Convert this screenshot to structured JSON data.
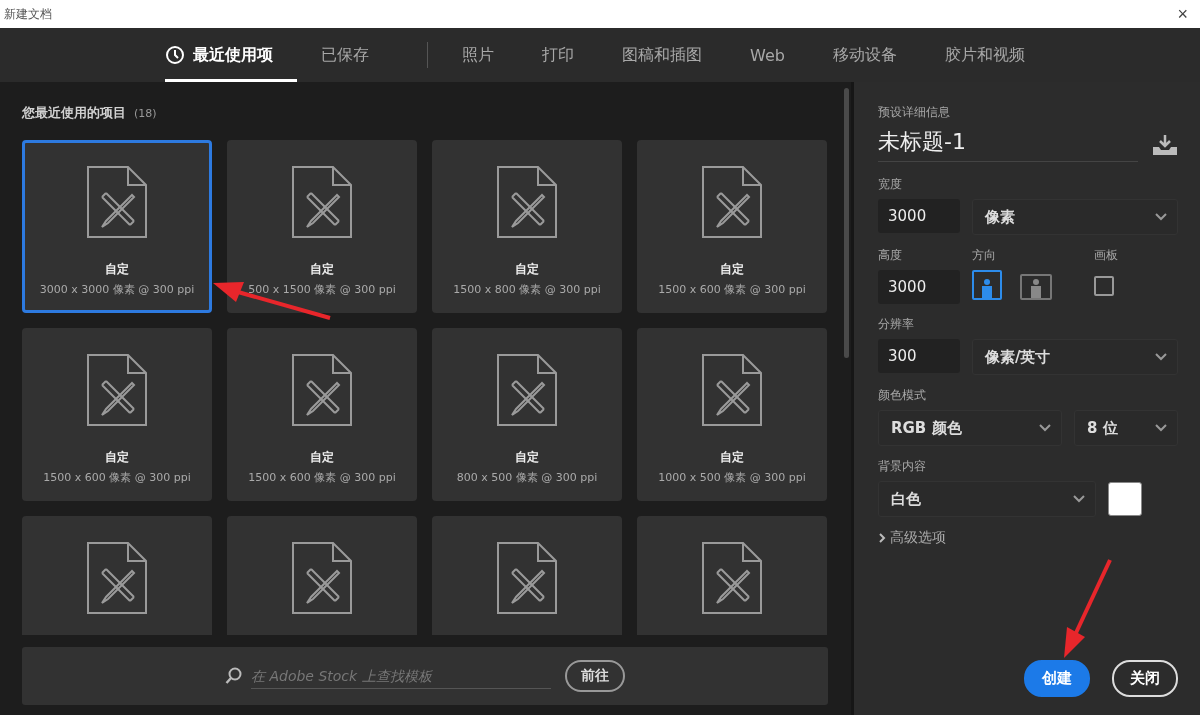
{
  "window": {
    "title": "新建文档",
    "close": "×"
  },
  "tabs": [
    {
      "label": "最近使用项",
      "kind": "recent",
      "selected": true
    },
    {
      "label": "已保存",
      "kind": "saved",
      "selected": false
    },
    {
      "label": "照片",
      "kind": "preset",
      "selected": false
    },
    {
      "label": "打印",
      "kind": "preset",
      "selected": false
    },
    {
      "label": "图稿和插图",
      "kind": "preset",
      "selected": false
    },
    {
      "label": "Web",
      "kind": "preset",
      "selected": false
    },
    {
      "label": "移动设备",
      "kind": "preset",
      "selected": false
    },
    {
      "label": "胶片和视频",
      "kind": "preset",
      "selected": false
    }
  ],
  "recent": {
    "heading": "您最近使用的项目",
    "count": "(18)",
    "items": [
      {
        "kind": "full",
        "name": "自定",
        "size": "3000 x 3000 像素 @ 300 ppi",
        "selected": true
      },
      {
        "kind": "full",
        "name": "自定",
        "size": "500 x 1500 像素 @ 300 ppi",
        "selected": false
      },
      {
        "kind": "full",
        "name": "自定",
        "size": "1500 x 800 像素 @ 300 ppi",
        "selected": false
      },
      {
        "kind": "full",
        "name": "自定",
        "size": "1500 x 600 像素 @ 300 ppi",
        "selected": false
      },
      {
        "kind": "full",
        "name": "自定",
        "size": "1500 x 600 像素 @ 300 ppi",
        "selected": false
      },
      {
        "kind": "full",
        "name": "自定",
        "size": "1500 x 600 像素 @ 300 ppi",
        "selected": false
      },
      {
        "kind": "full",
        "name": "自定",
        "size": "800 x 500 像素 @ 300 ppi",
        "selected": false
      },
      {
        "kind": "full",
        "name": "自定",
        "size": "1000 x 500 像素 @ 300 ppi",
        "selected": false
      },
      {
        "kind": "partial",
        "selected": false
      },
      {
        "kind": "partial",
        "selected": false
      },
      {
        "kind": "partial",
        "selected": false
      },
      {
        "kind": "partial",
        "selected": false
      }
    ]
  },
  "stock_search": {
    "placeholder": "在 Adobe Stock 上查找模板",
    "button": "前往"
  },
  "preset_details": {
    "heading": "预设详细信息",
    "name": "未标题-1",
    "width": {
      "label": "宽度",
      "value": "3000",
      "unit": "像素"
    },
    "height": {
      "label": "高度",
      "value": "3000"
    },
    "orientation": {
      "label": "方向",
      "options": [
        {
          "kind": "portrait",
          "selected": true
        },
        {
          "kind": "landscape",
          "selected": false
        }
      ]
    },
    "artboard": {
      "label": "画板",
      "checked": false
    },
    "resolution": {
      "label": "分辨率",
      "value": "300",
      "unit": "像素/英寸"
    },
    "color_mode": {
      "label": "颜色模式",
      "mode": "RGB 颜色",
      "depth": "8 位"
    },
    "background": {
      "label": "背景内容",
      "value": "白色",
      "color": "#ffffff"
    },
    "advanced": {
      "label": "高级选项",
      "expanded": false
    }
  },
  "buttons": [
    {
      "label": "创建",
      "kind": "primary"
    },
    {
      "label": "关闭",
      "kind": "secondary"
    }
  ]
}
